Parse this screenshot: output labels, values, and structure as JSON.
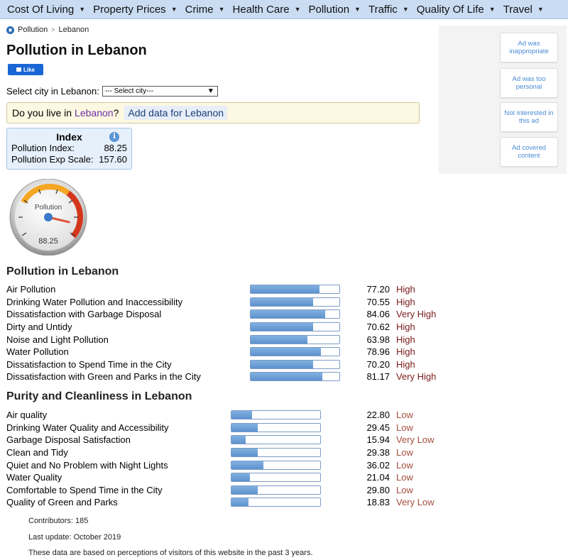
{
  "nav": {
    "items": [
      {
        "label": "Cost Of Living"
      },
      {
        "label": "Property Prices"
      },
      {
        "label": "Crime"
      },
      {
        "label": "Health Care"
      },
      {
        "label": "Pollution"
      },
      {
        "label": "Traffic"
      },
      {
        "label": "Quality Of Life"
      },
      {
        "label": "Travel"
      }
    ]
  },
  "breadcrumb": {
    "root": "Pollution",
    "separator": ">",
    "current": "Lebanon"
  },
  "title": "Pollution in Lebanon",
  "like_label": "Like",
  "select": {
    "label": "Select city in Lebanon:",
    "value": "--- Select city---"
  },
  "live": {
    "prefix": "Do you live in",
    "country": "Lebanon",
    "suffix": "?",
    "add_link": "Add data for Lebanon"
  },
  "index": {
    "title": "Index",
    "info_glyph": "i",
    "rows": [
      {
        "label": "Pollution Index:",
        "value": "88.25"
      },
      {
        "label": "Pollution Exp Scale:",
        "value": "157.60"
      }
    ]
  },
  "gauge": {
    "label": "Pollution",
    "value": "88.25",
    "level": 88.25
  },
  "ads": {
    "buttons": [
      {
        "label": "Ad was inappropriate"
      },
      {
        "label": "Ad was too personal"
      },
      {
        "label": "Not interested in this ad"
      },
      {
        "label": "Ad covered content"
      }
    ]
  },
  "pollution": {
    "heading": "Pollution in Lebanon",
    "rows": [
      {
        "label": "Air Pollution",
        "value": "77.20",
        "level": "High",
        "pct": 77.2
      },
      {
        "label": "Drinking Water Pollution and Inaccessibility",
        "value": "70.55",
        "level": "High",
        "pct": 70.55
      },
      {
        "label": "Dissatisfaction with Garbage Disposal",
        "value": "84.06",
        "level": "Very High",
        "pct": 84.06
      },
      {
        "label": "Dirty and Untidy",
        "value": "70.62",
        "level": "High",
        "pct": 70.62
      },
      {
        "label": "Noise and Light Pollution",
        "value": "63.98",
        "level": "High",
        "pct": 63.98
      },
      {
        "label": "Water Pollution",
        "value": "78.96",
        "level": "High",
        "pct": 78.96
      },
      {
        "label": "Dissatisfaction to Spend Time in the City",
        "value": "70.20",
        "level": "High",
        "pct": 70.2
      },
      {
        "label": "Dissatisfaction with Green and Parks in the City",
        "value": "81.17",
        "level": "Very High",
        "pct": 81.17
      }
    ]
  },
  "purity": {
    "heading": "Purity and Cleanliness in Lebanon",
    "rows": [
      {
        "label": "Air quality",
        "value": "22.80",
        "level": "Low",
        "pct": 22.8
      },
      {
        "label": "Drinking Water Quality and Accessibility",
        "value": "29.45",
        "level": "Low",
        "pct": 29.45
      },
      {
        "label": "Garbage Disposal Satisfaction",
        "value": "15.94",
        "level": "Very Low",
        "pct": 15.94
      },
      {
        "label": "Clean and Tidy",
        "value": "29.38",
        "level": "Low",
        "pct": 29.38
      },
      {
        "label": "Quiet and No Problem with Night Lights",
        "value": "36.02",
        "level": "Low",
        "pct": 36.02
      },
      {
        "label": "Water Quality",
        "value": "21.04",
        "level": "Low",
        "pct": 21.04
      },
      {
        "label": "Comfortable to Spend Time in the City",
        "value": "29.80",
        "level": "Low",
        "pct": 29.8
      },
      {
        "label": "Quality of Green and Parks",
        "value": "18.83",
        "level": "Very Low",
        "pct": 18.83
      }
    ]
  },
  "footer": {
    "contributors": "Contributors: 185",
    "last_update": "Last update: October 2019",
    "note": "These data are based on perceptions of visitors of this website in the past 3 years."
  },
  "colors": {
    "level_high": "#7a1a1a",
    "level_low": "#a34d3c",
    "bar_fill": "#6a9fd6",
    "nav_bg": "#c9dcf2"
  }
}
